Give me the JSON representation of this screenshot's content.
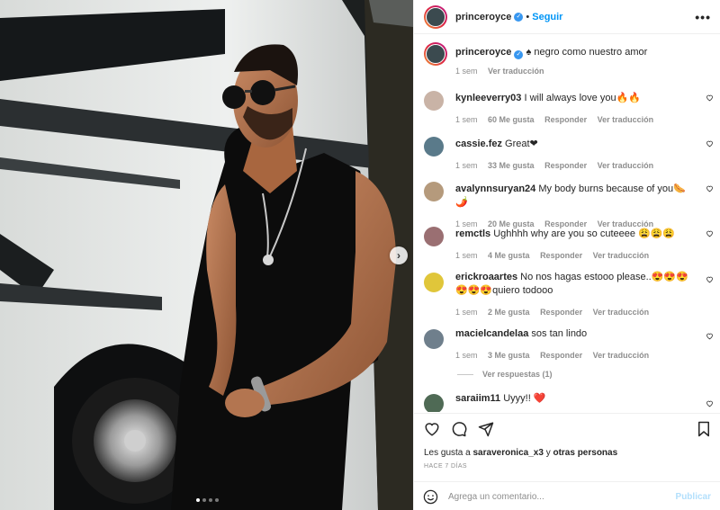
{
  "post": {
    "author": "princeroyce",
    "follow_label": "Seguir",
    "separator": "•",
    "caption": "♠ negro como nuestro amor",
    "caption_age": "1 sem",
    "see_translation": "Ver traducción"
  },
  "comments": [
    {
      "user": "kynleeverry03",
      "text": "I will always love you🔥🔥",
      "age": "1 sem",
      "likes": "60 Me gusta",
      "reply": "Responder",
      "translate": "Ver traducción",
      "avatar_color": "#c9b3a6"
    },
    {
      "user": "cassie.fez",
      "text": "Great❤",
      "age": "1 sem",
      "likes": "33 Me gusta",
      "reply": "Responder",
      "translate": "Ver traducción",
      "avatar_color": "#5a7a8a"
    },
    {
      "user": "avalynnsuryan24",
      "text": "My body burns because of you🌭🌶️",
      "age": "1 sem",
      "likes": "20 Me gusta",
      "reply": "Responder",
      "translate": "Ver traducción",
      "avatar_color": "#b59a7c"
    },
    {
      "user": "remctls",
      "text": "Ughhhh why are you so cuteeee 😩😩😩",
      "age": "1 sem",
      "likes": "4 Me gusta",
      "reply": "Responder",
      "translate": "Ver traducción",
      "avatar_color": "#9a6f72"
    },
    {
      "user": "erickroaartes",
      "text": "No nos hagas estooo please..😍😍😍😍😍😍quiero todooo",
      "age": "1 sem",
      "likes": "2 Me gusta",
      "reply": "Responder",
      "translate": "Ver traducción",
      "avatar_color": "#e0c63a"
    },
    {
      "user": "macielcandelaa",
      "text": "sos tan lindo",
      "age": "1 sem",
      "likes": "3 Me gusta",
      "reply": "Responder",
      "translate": "Ver traducción",
      "avatar_color": "#6f7f8c"
    },
    {
      "user": "saraiim11",
      "text": "Uyyy!! ❤️",
      "avatar_color": "#4f6a55"
    }
  ],
  "view_replies": "Ver respuestas (1)",
  "liked_by": {
    "prefix": "Les gusta a",
    "user": "saraveronica_x3",
    "joiner": "y",
    "others": "otras personas"
  },
  "post_age": "HACE 7 DÍAS",
  "composer": {
    "placeholder": "Agrega un comentario...",
    "publish": "Publicar"
  },
  "colors": {
    "accent": "#0095f6",
    "verified": "#3897f0",
    "heart": "#ed4956"
  }
}
